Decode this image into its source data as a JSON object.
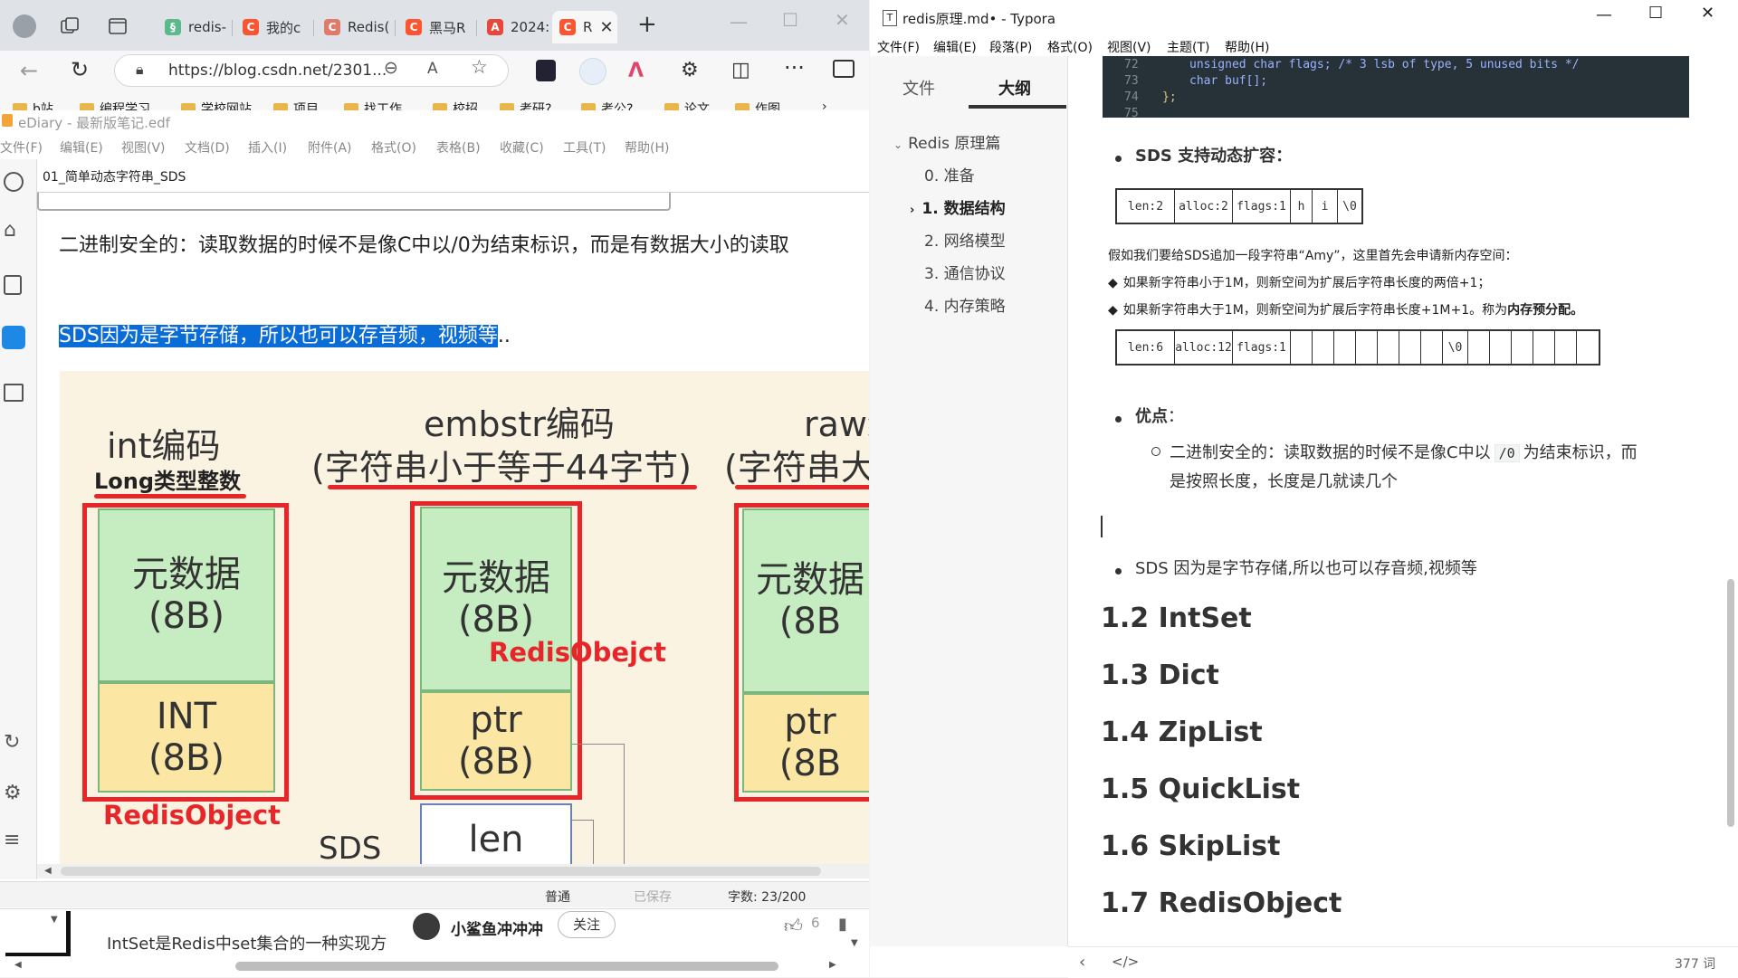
{
  "browser": {
    "tabs": [
      {
        "label": "redis-"
      },
      {
        "label": "我的с"
      },
      {
        "label": "Redis("
      },
      {
        "label": "黑马R"
      },
      {
        "label": "2024:"
      },
      {
        "label": "R"
      }
    ],
    "url": "https://blog.csdn.net/2301...",
    "bookmarks": [
      "b站",
      "编程学习",
      "学校网站",
      "项目",
      "找工作",
      "校招",
      "考研?",
      "考公?",
      "论文",
      "作图"
    ]
  },
  "ediary": {
    "title": "eDiary - 最新版笔记.edf",
    "menu": [
      "文件(F)",
      "编辑(E)",
      "视图(V)",
      "文档(D)",
      "插入(I)",
      "附件(A)",
      "格式(O)",
      "表格(B)",
      "收藏(C)",
      "工具(T)",
      "帮助(H)"
    ],
    "doc_tab": "01_简单动态字符串_SDS",
    "para1": "二进制安全的：读取数据的时候不是像C中以/0为结束标识，而是有数据大小的读取",
    "para2_selected": "SDS因为是字节存储，所以也可以存音频，视频等",
    "para2_tail": "..",
    "diagram": {
      "int_title": "int编码",
      "int_sub": "Long类型整数",
      "embstr_title": "embstr编码",
      "embstr_sub": "(字符串小于等于44字节)",
      "raw_title": "raw编",
      "raw_sub": "(字符串大",
      "meta": "元数据",
      "meta_size": "(8B)",
      "int_cell": "INT",
      "int_size": "(8B)",
      "ptr": "ptr",
      "ptr_size": "(8B)",
      "len": "len",
      "sds": "SDS",
      "redisobject_label": "RedisObject",
      "redisobject_label2": "RedisObejct",
      "raw_meta": "元数据",
      "raw_meta_size": "(8B",
      "raw_ptr": "ptr",
      "raw_ptr_size": "(8B"
    },
    "status": {
      "mode": "普通",
      "saved": "已保存",
      "wordcount": "字数: 23/200"
    }
  },
  "csdn": {
    "snippet": "IntSet是Redis中set集合的一种实现方式",
    "author": "小鲨鱼冲冲冲",
    "follow": "关注",
    "likes": "6"
  },
  "typora": {
    "title": "redis原理.md• - Typora",
    "menu": [
      "文件(F)",
      "编辑(E)",
      "段落(P)",
      "格式(O)",
      "视图(V)",
      "主题(T)",
      "帮助(H)"
    ],
    "sidebar_tabs": [
      "文件",
      "大纲"
    ],
    "outline": {
      "root": "Redis 原理篇",
      "items": [
        "0. 准备",
        "1. 数据结构",
        "2. 网络模型",
        "3. 通信协议",
        "4. 内存策略"
      ]
    },
    "code_lines": [
      {
        "num": "72",
        "text": "unsigned char flags; /* 3 lsb of type, 5 unused bits */"
      },
      {
        "num": "73",
        "text": "char buf[];"
      },
      {
        "num": "74",
        "text": "};"
      },
      {
        "num": "75",
        "text": ""
      }
    ],
    "sds_heading": "SDS 支持动态扩容：",
    "sds_row1": [
      "len:2",
      "alloc:2",
      "flags:1",
      "h",
      "i",
      "\\0"
    ],
    "append_text": "假如我们要给SDS追加一段字符串“Amy”，这里首先会申请新内存空间：",
    "rule1": "如果新字符串小于1M，则新空间为扩展后字符串长度的两倍+1；",
    "rule2": "如果新字符串大于1M，则新空间为扩展后字符串长度+1M+1。称为",
    "rule2_bold": "内存预分配。",
    "sds_row2": [
      "len:6",
      "alloc:12",
      "flags:1",
      "",
      "",
      "",
      "",
      "",
      "",
      "",
      "\\0",
      "",
      "",
      "",
      "",
      "",
      ""
    ],
    "pros": "优点",
    "pros_colon": "：",
    "pro1_a": "二进制安全的：读取数据的时候不是像C中以",
    "pro1_code": "/0",
    "pro1_b": "为结束标识，而",
    "pro1_c": "是按照长度，长度是几就读几个",
    "sds_storage": "SDS 因为是字节存储,所以也可以存音频,视频等",
    "headings": [
      "1.2 IntSet",
      "1.3 Dict",
      "1.4 ZipList",
      "1.5 QuickList",
      "1.6 SkipList",
      "1.7 RedisObject"
    ],
    "word_count": "377 词"
  },
  "colors": {
    "selection": "#0a6cd6",
    "red": "#e8262a",
    "green_cell": "#c6ecc1",
    "yellow_cell": "#fbe6a4",
    "csdn": "#fc5531"
  }
}
